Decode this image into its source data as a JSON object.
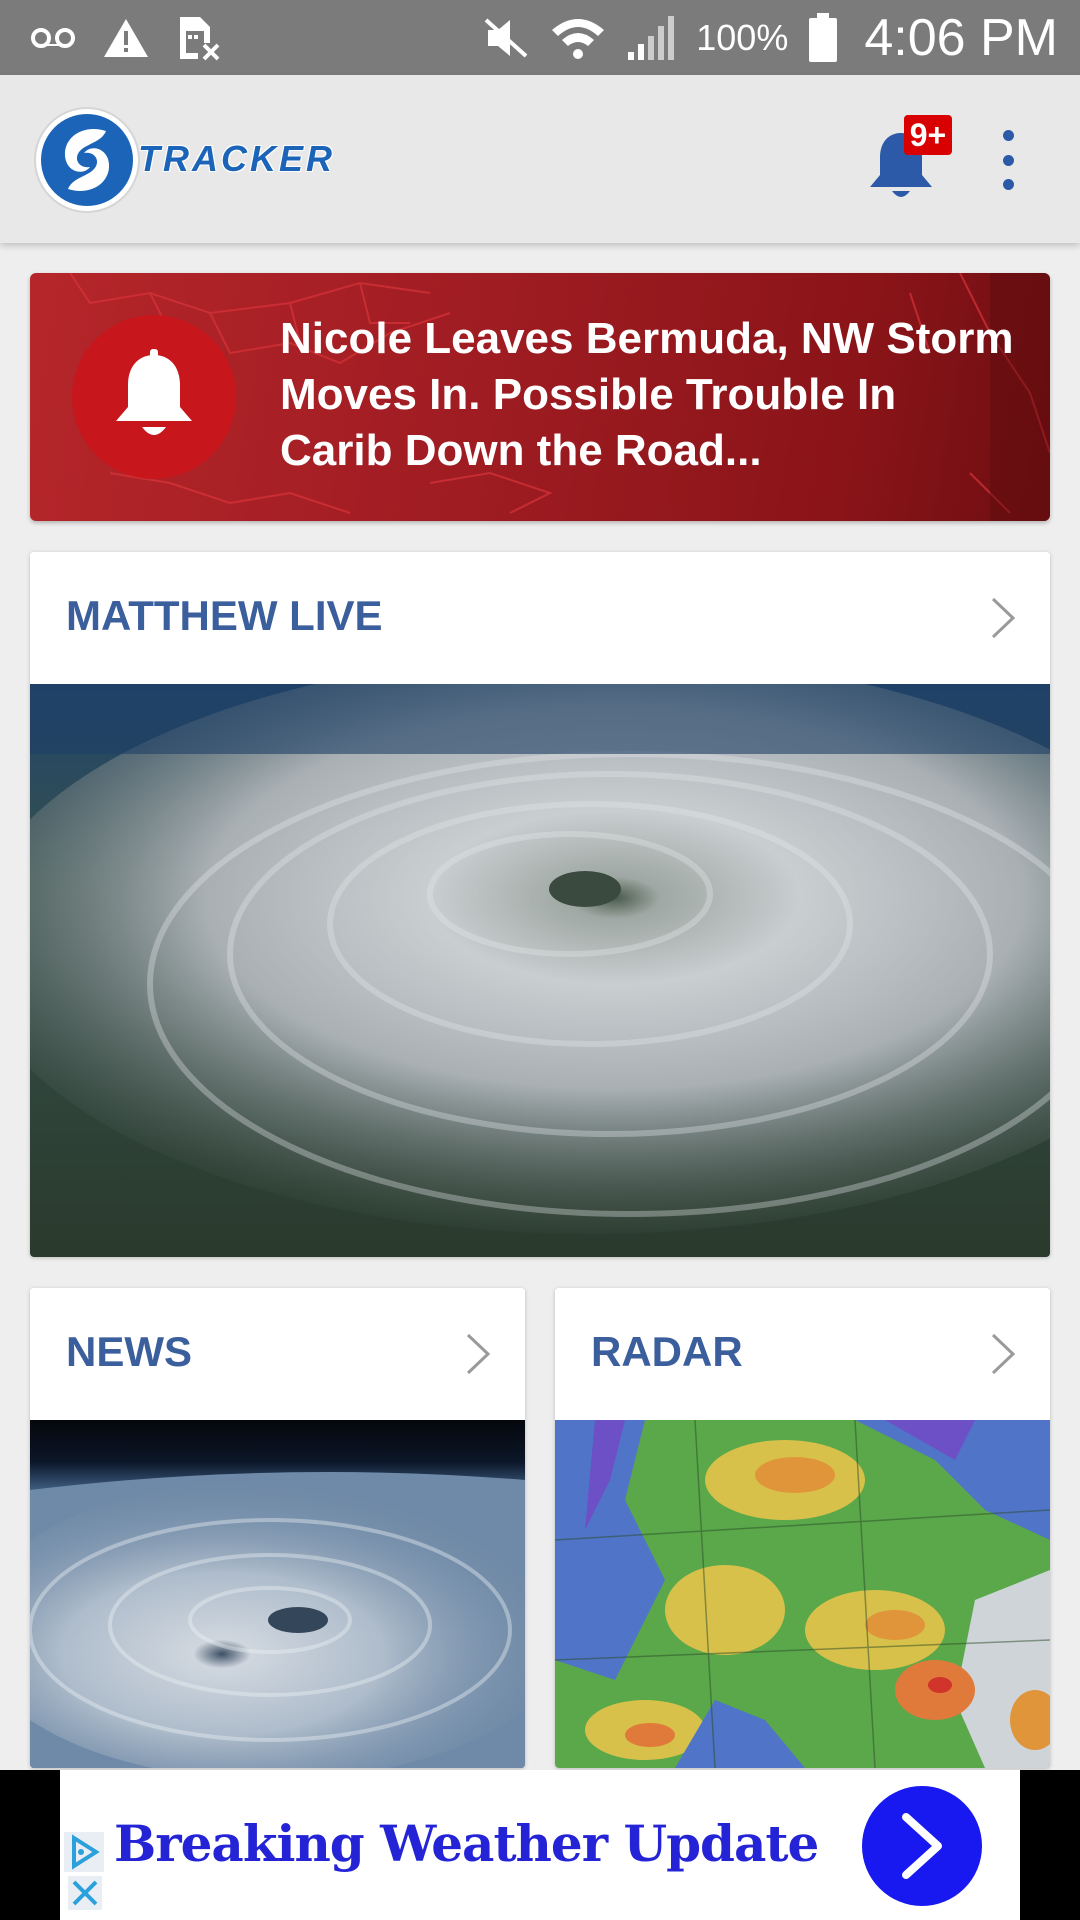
{
  "status_bar": {
    "battery_percent": "100%",
    "time": "4:06 PM",
    "icons": [
      "voicemail-icon",
      "warning-icon",
      "sim-off-icon",
      "mute-icon",
      "wifi-icon",
      "signal-icon",
      "battery-icon"
    ]
  },
  "app_bar": {
    "logo_text": "TRACKER",
    "notification_badge": "9+",
    "colors": {
      "brand_blue": "#1b64b8",
      "badge_red": "#d80000"
    }
  },
  "alert": {
    "headline": "Nicole Leaves Bermuda, NW Storm Moves In. Possible Trouble In Carib Down the Road...",
    "icon": "bell-icon",
    "color": "#b5262a"
  },
  "cards": {
    "live": {
      "title": "MATTHEW LIVE"
    },
    "news": {
      "title": "NEWS"
    },
    "radar": {
      "title": "RADAR"
    }
  },
  "ad": {
    "text": "Breaking Weather Update",
    "cta_icon": "chevron-right-icon",
    "color": "#1818f0"
  }
}
